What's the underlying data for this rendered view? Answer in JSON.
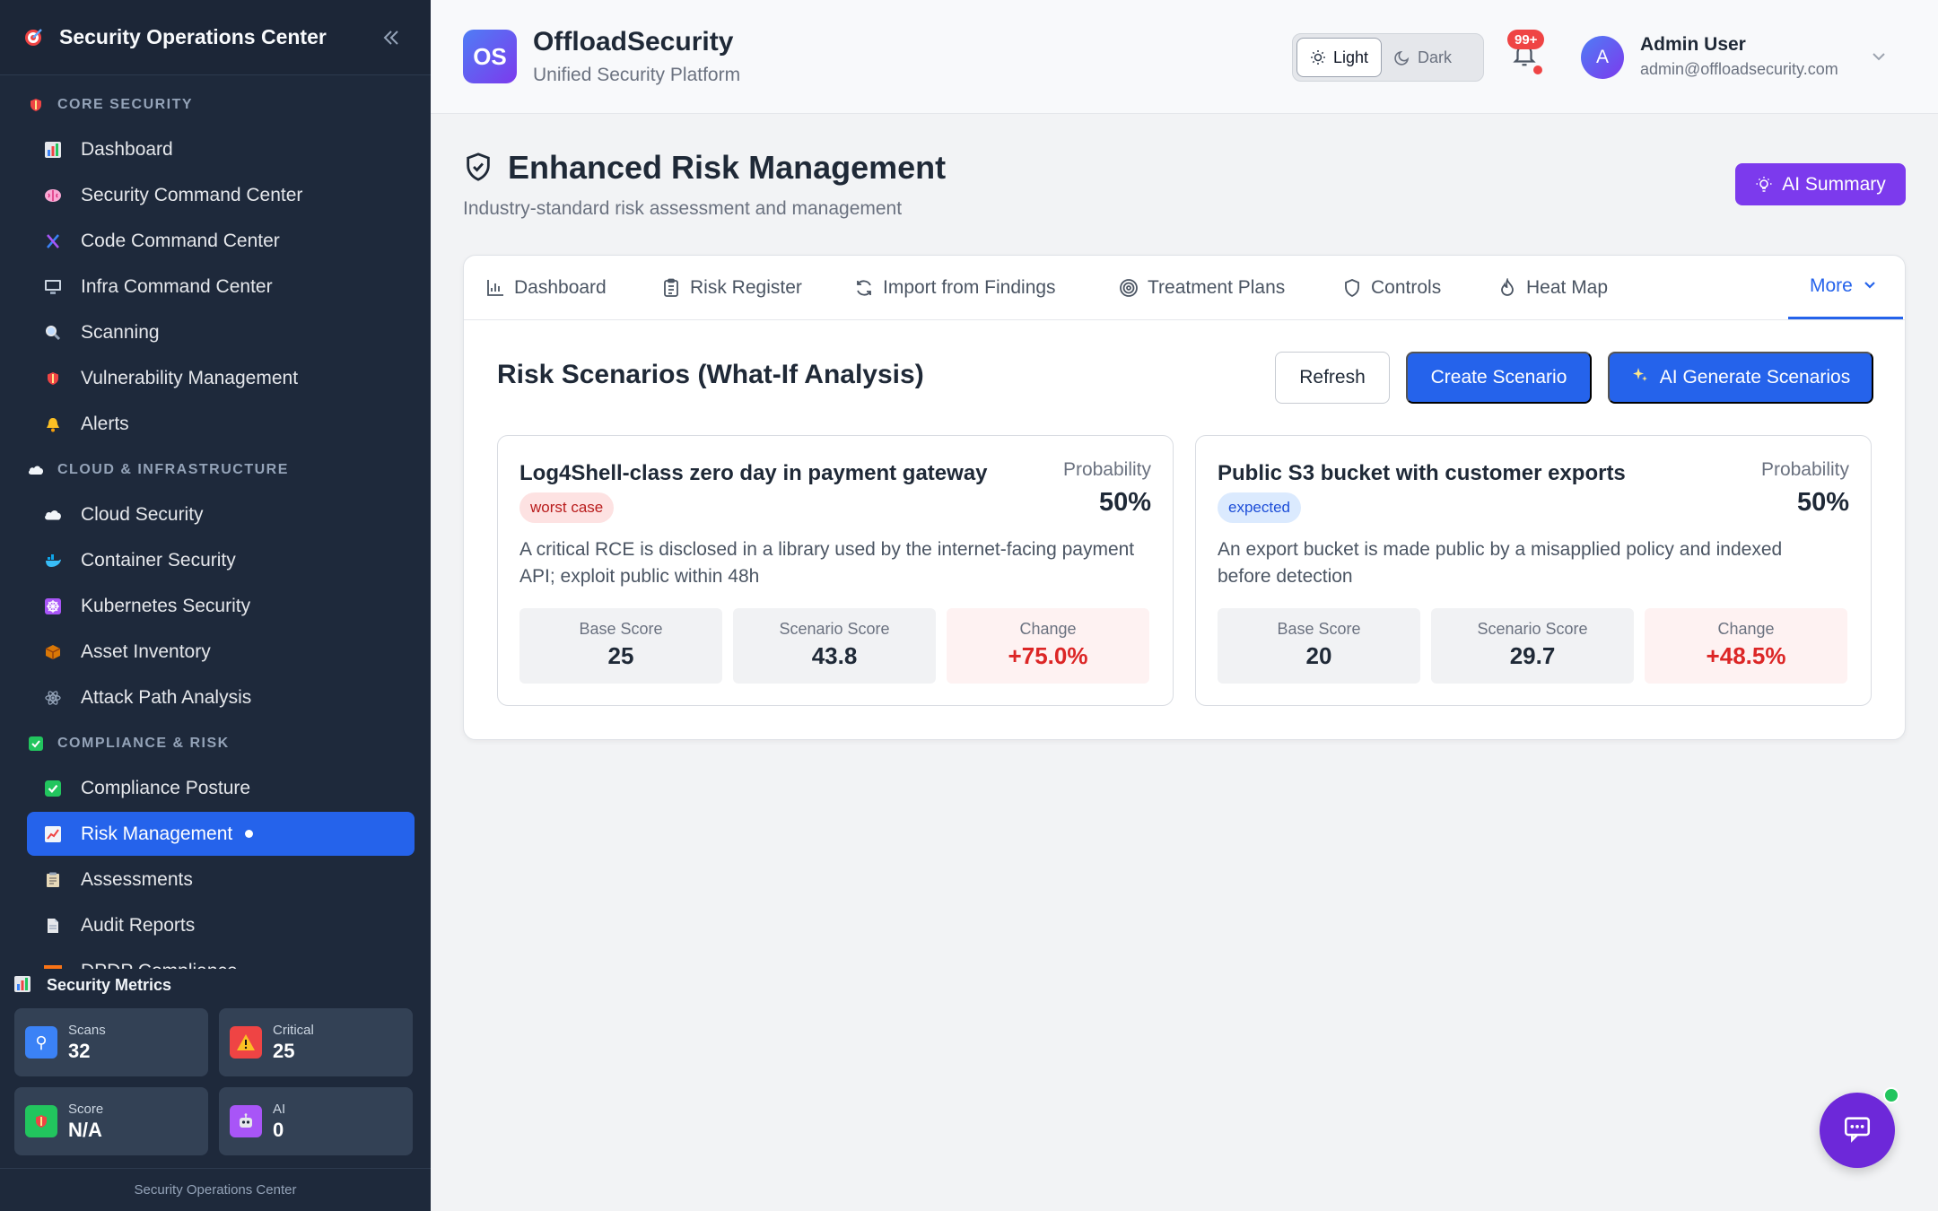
{
  "sidebar": {
    "title": "Security Operations Center",
    "sections": [
      {
        "label": "CORE SECURITY",
        "icon": "shield-icon",
        "items": [
          {
            "label": "Dashboard",
            "icon": "bar-chart-icon"
          },
          {
            "label": "Security Command Center",
            "icon": "brain-icon"
          },
          {
            "label": "Code Command Center",
            "icon": "dna-icon"
          },
          {
            "label": "Infra Command Center",
            "icon": "monitor-icon"
          },
          {
            "label": "Scanning",
            "icon": "magnifier-icon"
          },
          {
            "label": "Vulnerability Management",
            "icon": "shield-icon"
          },
          {
            "label": "Alerts",
            "icon": "bell-icon"
          }
        ]
      },
      {
        "label": "CLOUD & INFRASTRUCTURE",
        "icon": "cloud-icon",
        "items": [
          {
            "label": "Cloud Security",
            "icon": "cloud-icon"
          },
          {
            "label": "Container Security",
            "icon": "whale-icon"
          },
          {
            "label": "Kubernetes Security",
            "icon": "helm-icon"
          },
          {
            "label": "Asset Inventory",
            "icon": "package-icon"
          },
          {
            "label": "Attack Path Analysis",
            "icon": "atom-icon"
          }
        ]
      },
      {
        "label": "COMPLIANCE & RISK",
        "icon": "check-box-icon",
        "items": [
          {
            "label": "Compliance Posture",
            "icon": "check-box-icon"
          },
          {
            "label": "Risk Management",
            "icon": "trend-icon",
            "active": true
          },
          {
            "label": "Assessments",
            "icon": "clipboard-icon"
          },
          {
            "label": "Audit Reports",
            "icon": "document-icon"
          },
          {
            "label": "DPDP Compliance",
            "icon": "flag-icon"
          }
        ]
      }
    ],
    "metrics": {
      "title": "Security Metrics",
      "cards": [
        {
          "label": "Scans",
          "value": "32",
          "color": "#3b82f6",
          "icon": "magnifier-icon"
        },
        {
          "label": "Critical",
          "value": "25",
          "color": "#ef4444",
          "icon": "warning-icon"
        },
        {
          "label": "Score",
          "value": "N/A",
          "color": "#22c55e",
          "icon": "shield-icon"
        },
        {
          "label": "AI",
          "value": "0",
          "color": "#a855f7",
          "icon": "robot-icon"
        }
      ]
    },
    "footer": "Security Operations Center"
  },
  "header": {
    "logo_text": "OS",
    "brand": "OffloadSecurity",
    "tagline": "Unified Security Platform",
    "theme": {
      "light": "Light",
      "dark": "Dark",
      "selected": "Light"
    },
    "notifications_badge": "99+",
    "avatar_initial": "A",
    "user_name": "Admin User",
    "user_email": "admin@offloadsecurity.com"
  },
  "page": {
    "title": "Enhanced Risk Management",
    "subtitle": "Industry-standard risk assessment and management",
    "ai_summary_label": "AI Summary",
    "tabs": [
      {
        "label": "Dashboard",
        "icon": "bar-chart-icon"
      },
      {
        "label": "Risk Register",
        "icon": "clipboard-icon"
      },
      {
        "label": "Import from Findings",
        "icon": "refresh-icon"
      },
      {
        "label": "Treatment Plans",
        "icon": "target-icon"
      },
      {
        "label": "Controls",
        "icon": "shield-icon"
      },
      {
        "label": "Heat Map",
        "icon": "flame-icon"
      }
    ],
    "more_label": "More",
    "section_title": "Risk Scenarios (What-If Analysis)",
    "buttons": {
      "refresh": "Refresh",
      "create": "Create Scenario",
      "ai_generate": "AI Generate Scenarios"
    },
    "scenarios": [
      {
        "title": "Log4Shell-class zero day in payment gateway",
        "tag": "worst case",
        "probability_label": "Probability",
        "probability": "50%",
        "description": "A critical RCE is disclosed in a library used by the internet-facing payment API; exploit public within 48h",
        "base_label": "Base Score",
        "base": "25",
        "scenario_label": "Scenario Score",
        "scenario": "43.8",
        "change_label": "Change",
        "change": "+75.0%"
      },
      {
        "title": "Public S3 bucket with customer exports",
        "tag": "expected",
        "probability_label": "Probability",
        "probability": "50%",
        "description": "An export bucket is made public by a misapplied policy and indexed before detection",
        "base_label": "Base Score",
        "base": "20",
        "scenario_label": "Scenario Score",
        "scenario": "29.7",
        "change_label": "Change",
        "change": "+48.5%"
      }
    ]
  },
  "colors": {
    "accent": "#2563eb",
    "purple": "#7c3aed",
    "sidebar_bg": "#1e293b",
    "danger": "#dc2626"
  }
}
